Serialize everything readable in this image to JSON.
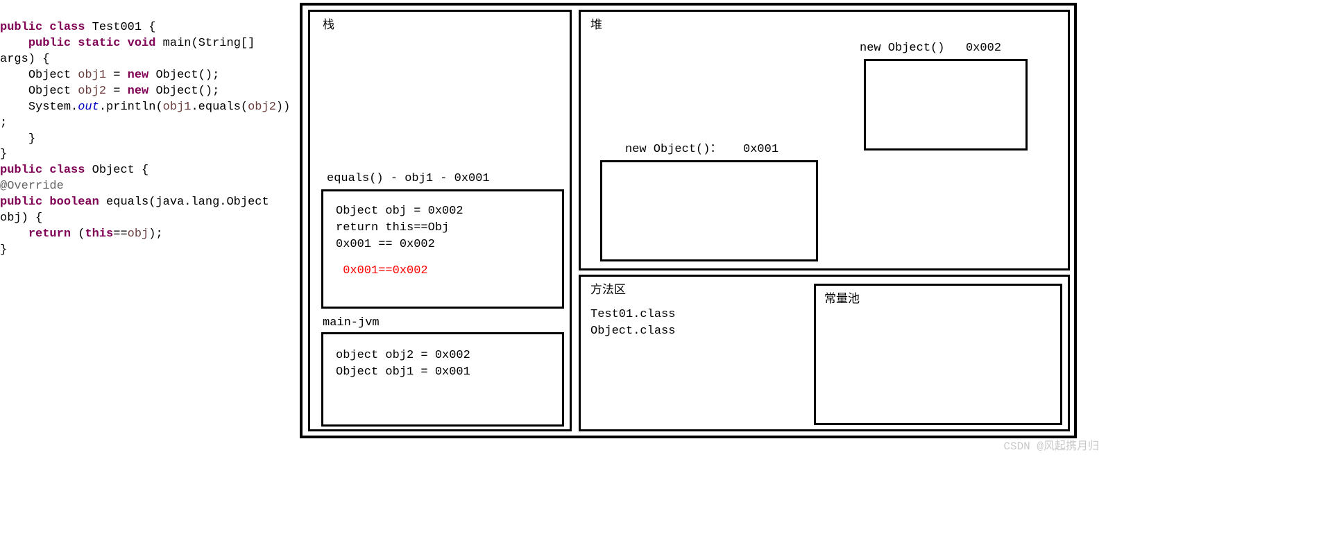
{
  "code": {
    "l1_public": "public",
    "l1_class": "class",
    "l1_name": "Test001",
    "l1_brace": " {",
    "l2_public": "public",
    "l2_static": "static",
    "l2_void": "void",
    "l2_main": "main",
    "l2_type": "String",
    "l3_args": "args) {",
    "l4_Object": "Object",
    "l4_obj1": "obj1",
    "l4_eq": " = ",
    "l4_new": "new",
    "l4_ctor": " Object();",
    "l5_Object": "Object",
    "l5_obj2": "obj2",
    "l5_eq": " = ",
    "l5_new": "new",
    "l5_ctor": " Object();",
    "l6a": "System.",
    "l6b": "out",
    "l6c": ".println(",
    "l6d": "obj1",
    "l6e": ".equals(",
    "l6f": "obj2",
    "l6g": "))",
    "l7": ";",
    "l8": "    }",
    "l9": "}",
    "l10_public": "public",
    "l10_class": "class",
    "l10_name": "Object {",
    "l11": "@Override",
    "l12_public": "public",
    "l12_boolean": "boolean",
    "l12_rest": "equals(java.lang.Object ",
    "l13": "obj) {",
    "l14_return": "return",
    "l14_open": " (",
    "l14_this": "this",
    "l14_eq": "==",
    "l14_obj": "obj",
    "l14_close": ");",
    "l15": "}"
  },
  "stack": {
    "title": "栈",
    "equalsFrameHeader": "equals() - obj1 - 0x001",
    "equalsFrame": {
      "l1": "Object obj = 0x002",
      "l2": "return this==Obj",
      "l3": "0x001 == 0x002",
      "l4": " 0x001==0x002"
    },
    "mainHeader": "main-jvm",
    "mainFrame": {
      "l1": "object obj2 = 0x002",
      "l2": "Object obj1 = 0x001"
    }
  },
  "heap": {
    "title": "堆",
    "obj1Label": "new Object()：   0x001",
    "obj2Label": "new Object()   0x002"
  },
  "methodArea": {
    "title": "方法区",
    "l1": "Test01.class",
    "l2": "Object.class"
  },
  "constantPool": {
    "title": "常量池"
  },
  "watermark": "CSDN @风起携月归"
}
